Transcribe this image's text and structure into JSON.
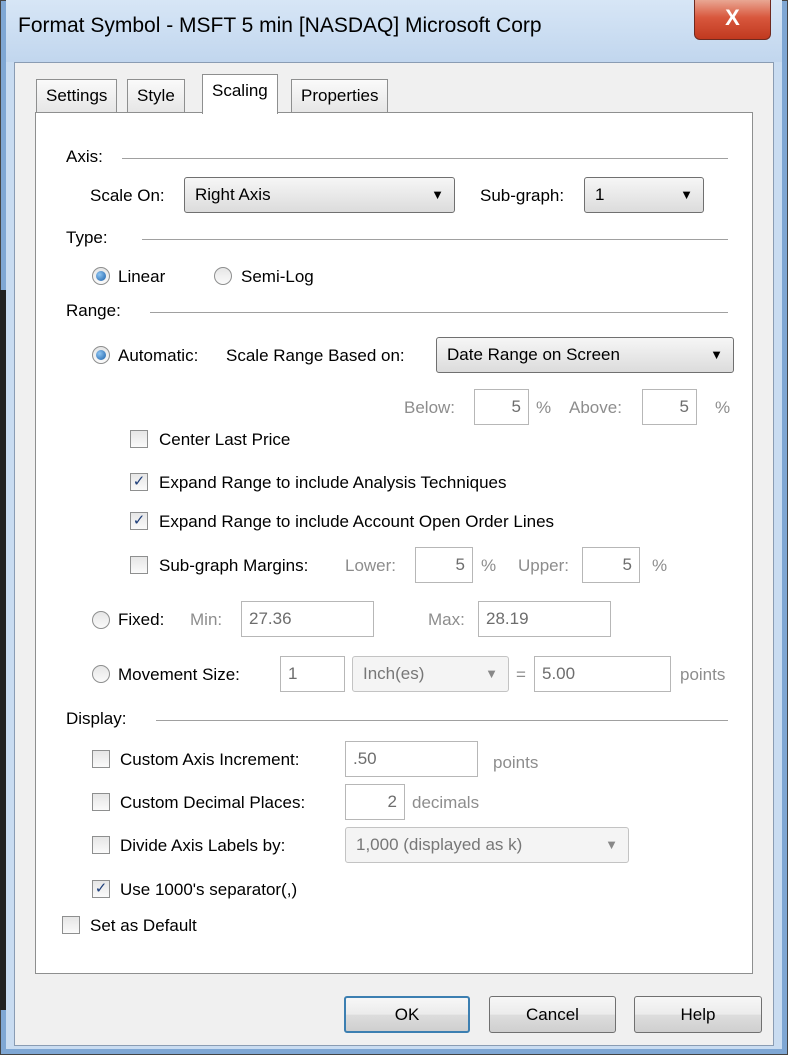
{
  "window": {
    "title": "Format Symbol - MSFT 5 min [NASDAQ] Microsoft Corp",
    "close_glyph": "X"
  },
  "tabs": [
    {
      "label": "Settings",
      "active": false
    },
    {
      "label": "Style",
      "active": false
    },
    {
      "label": "Scaling",
      "active": true
    },
    {
      "label": "Properties",
      "active": false
    }
  ],
  "axis": {
    "header": "Axis:",
    "scale_on_label": "Scale On:",
    "scale_on_value": "Right Axis",
    "subgraph_label": "Sub-graph:",
    "subgraph_value": "1"
  },
  "type": {
    "header": "Type:",
    "linear_label": "Linear",
    "semilog_label": "Semi-Log",
    "selected": "Linear"
  },
  "range": {
    "header": "Range:",
    "automatic_label": "Automatic:",
    "scale_range_label": "Scale Range Based on:",
    "scale_range_value": "Date Range on Screen",
    "below_label": "Below:",
    "below_value": "5",
    "above_label": "Above:",
    "above_value": "5",
    "percent": "%",
    "center_last_price_label": "Center Last Price",
    "center_last_price_checked": false,
    "expand_analysis_label": "Expand Range to include Analysis Techniques",
    "expand_analysis_checked": true,
    "expand_orders_label": "Expand Range to include Account Open Order Lines",
    "expand_orders_checked": true,
    "subgraph_margins_label": "Sub-graph Margins:",
    "subgraph_margins_checked": false,
    "lower_label": "Lower:",
    "lower_value": "5",
    "upper_label": "Upper:",
    "upper_value": "5",
    "fixed_label": "Fixed:",
    "min_label": "Min:",
    "min_value": "27.36",
    "max_label": "Max:",
    "max_value": "28.19",
    "movement_label": "Movement Size:",
    "movement_value": "1",
    "movement_unit": "Inch(es)",
    "equals": "=",
    "movement_points_value": "5.00",
    "points_label": "points",
    "selected": "Automatic"
  },
  "display": {
    "header": "Display:",
    "custom_increment_label": "Custom Axis Increment:",
    "custom_increment_checked": false,
    "custom_increment_value": ".50",
    "increment_points_label": "points",
    "custom_decimal_label": "Custom Decimal Places:",
    "custom_decimal_checked": false,
    "decimal_value": "2",
    "decimals_label": "decimals",
    "divide_label": "Divide Axis Labels by:",
    "divide_checked": false,
    "divide_value": "1,000 (displayed as k)",
    "separator_label": "Use 1000's separator(,)",
    "separator_checked": true
  },
  "set_default_label": "Set as Default",
  "set_default_checked": false,
  "buttons": {
    "ok": "OK",
    "cancel": "Cancel",
    "help": "Help"
  },
  "glyphs": {
    "check": "✓",
    "dropdown": "▼"
  },
  "colors": {
    "title_bar": "#c9dcf1",
    "close_button": "#c8412a",
    "default_button_border": "#3c7fb1",
    "radio_dot": "#1a5fa8"
  }
}
